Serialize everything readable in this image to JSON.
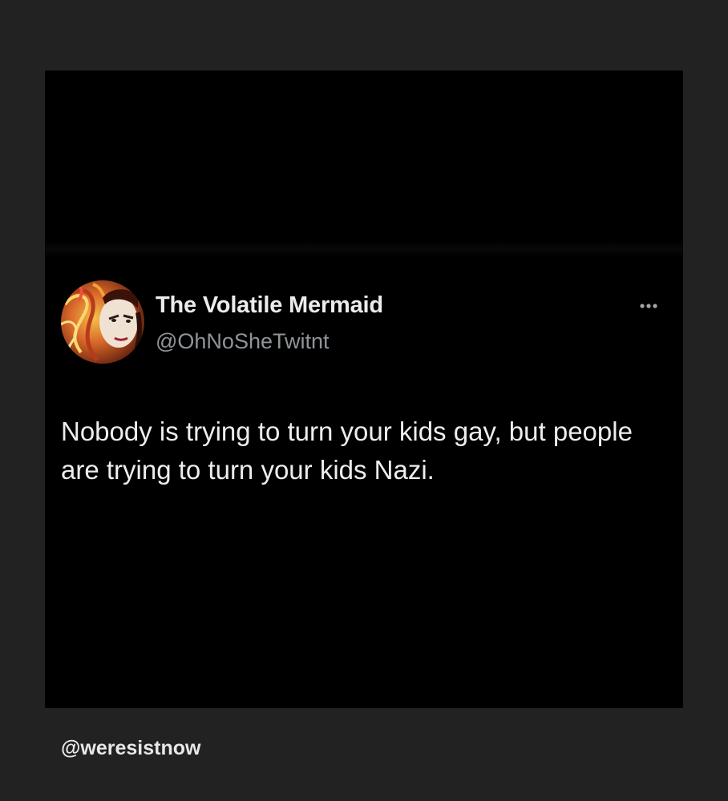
{
  "post": {
    "author": {
      "display_name": "The Volatile Mermaid",
      "handle": "@OhNoSheTwitnt",
      "avatar_icon": "avatar-portrait"
    },
    "more_icon": "ellipsis-icon",
    "text": "Nobody is trying to turn your kids gay, but people are trying to turn your kids Nazi."
  },
  "footer": {
    "credit": "@weresistnow"
  },
  "colors": {
    "page_background": "#222222",
    "card_background": "#000000",
    "name_text": "#ececec",
    "handle_text": "#8f9499",
    "body_text": "#ededed"
  }
}
